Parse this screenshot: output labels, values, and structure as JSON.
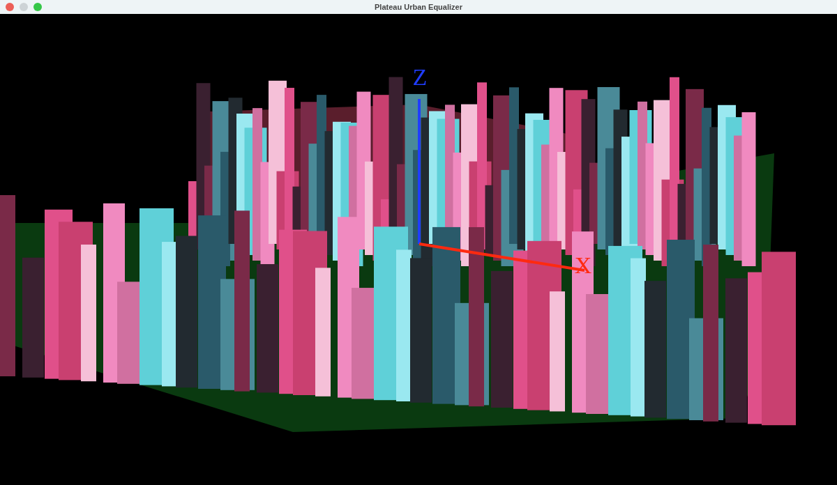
{
  "window": {
    "title": "Plateau Urban Equalizer"
  },
  "axes": [
    {
      "kind": "z",
      "label": "Z",
      "color": "#1f3dff"
    },
    {
      "kind": "x",
      "label": "X",
      "color": "#ff2a10"
    }
  ]
}
